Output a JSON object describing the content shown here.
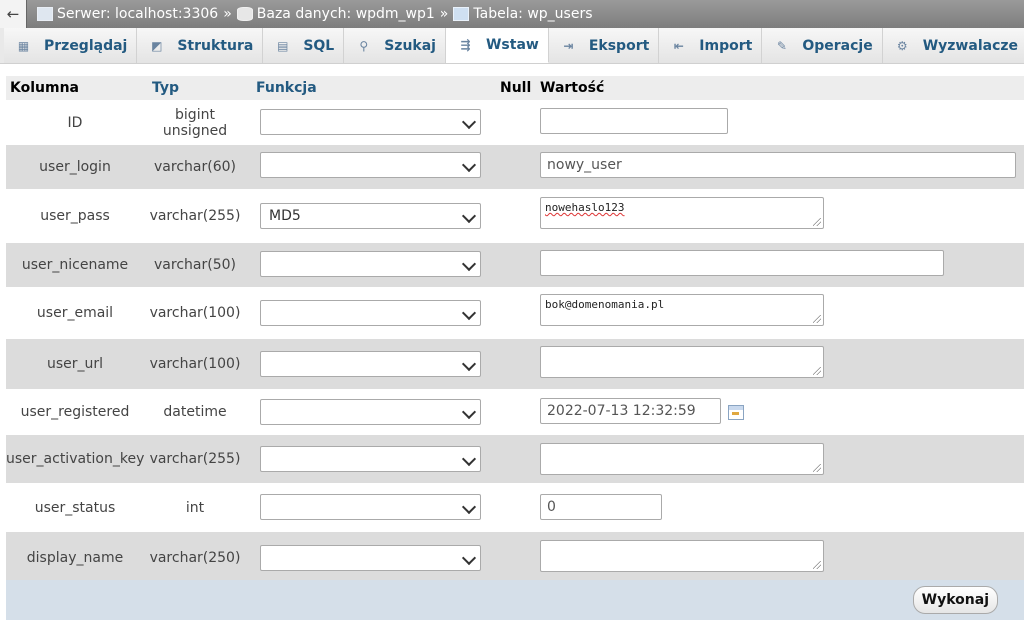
{
  "breadcrumb": {
    "back": "←",
    "server": "Serwer: localhost:3306",
    "database": "Baza danych: wpdm_wp1",
    "table": "Tabela: wp_users",
    "separator": "»"
  },
  "tabs": [
    {
      "label": "Przeglądaj",
      "icon": "browse-icon"
    },
    {
      "label": "Struktura",
      "icon": "structure-icon"
    },
    {
      "label": "SQL",
      "icon": "sql-icon"
    },
    {
      "label": "Szukaj",
      "icon": "search-icon"
    },
    {
      "label": "Wstaw",
      "icon": "insert-icon",
      "active": true
    },
    {
      "label": "Eksport",
      "icon": "export-icon"
    },
    {
      "label": "Import",
      "icon": "import-icon"
    },
    {
      "label": "Operacje",
      "icon": "wrench-icon"
    },
    {
      "label": "Wyzwalacze",
      "icon": "triggers-icon"
    }
  ],
  "headers": {
    "column": "Kolumna",
    "type": "Typ",
    "function": "Funkcja",
    "null": "Null",
    "value": "Wartość"
  },
  "rows": [
    {
      "column": "ID",
      "type": "bigint unsigned",
      "function": "",
      "value": ""
    },
    {
      "column": "user_login",
      "type": "varchar(60)",
      "function": "",
      "value": "nowy_user"
    },
    {
      "column": "user_pass",
      "type": "varchar(255)",
      "function": "MD5",
      "value": "nowehaslo123"
    },
    {
      "column": "user_nicename",
      "type": "varchar(50)",
      "function": "",
      "value": ""
    },
    {
      "column": "user_email",
      "type": "varchar(100)",
      "function": "",
      "value": "bok@domenomania.pl"
    },
    {
      "column": "user_url",
      "type": "varchar(100)",
      "function": "",
      "value": ""
    },
    {
      "column": "user_registered",
      "type": "datetime",
      "function": "",
      "value": "2022-07-13 12:32:59"
    },
    {
      "column": "user_activation_key",
      "type": "varchar(255)",
      "function": "",
      "value": ""
    },
    {
      "column": "user_status",
      "type": "int",
      "function": "",
      "value": "0"
    },
    {
      "column": "display_name",
      "type": "varchar(250)",
      "function": "",
      "value": ""
    }
  ],
  "submit_label": "Wykonaj",
  "colors": {
    "tab_text": "#235a81",
    "odd_row": "#ffffff",
    "even_row": "#dcdcdc",
    "footer": "#d5dfe9"
  }
}
